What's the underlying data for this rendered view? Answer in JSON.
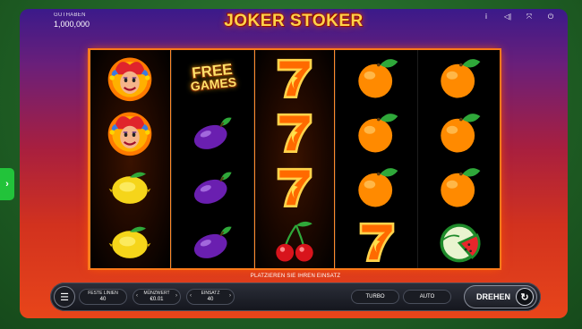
{
  "header": {
    "balance_label": "GUTHABEN",
    "balance_value": "1,000,000",
    "title": "JOKER STOKER",
    "icons": [
      "info-icon",
      "sound-icon",
      "fullscreen-icon",
      "power-icon"
    ]
  },
  "reels": [
    [
      "joker",
      "joker",
      "lemon",
      "lemon"
    ],
    [
      "free-games",
      "plum",
      "plum",
      "plum"
    ],
    [
      "seven",
      "seven",
      "seven",
      "cherry"
    ],
    [
      "orange",
      "orange",
      "orange",
      "seven"
    ],
    [
      "orange",
      "orange",
      "orange",
      "watermelon"
    ]
  ],
  "free_games": {
    "line1": "FREE",
    "line2": "GAMES"
  },
  "controls": {
    "instruction": "PLATZIEREN SIE IHREN EINSATZ",
    "lines_label": "FESTE LINIEN",
    "lines_value": "40",
    "coin_label": "MÜNZWERT",
    "coin_value": "€0.01",
    "bet_label": "EINSATZ",
    "bet_value": "40",
    "turbo": "TURBO",
    "auto": "AUTO",
    "spin": "DREHEN"
  },
  "side_tab": "›",
  "colors": {
    "reel_frame": "#ff7a1a",
    "side_tab": "#22c33a",
    "title": "#ffd34a"
  }
}
